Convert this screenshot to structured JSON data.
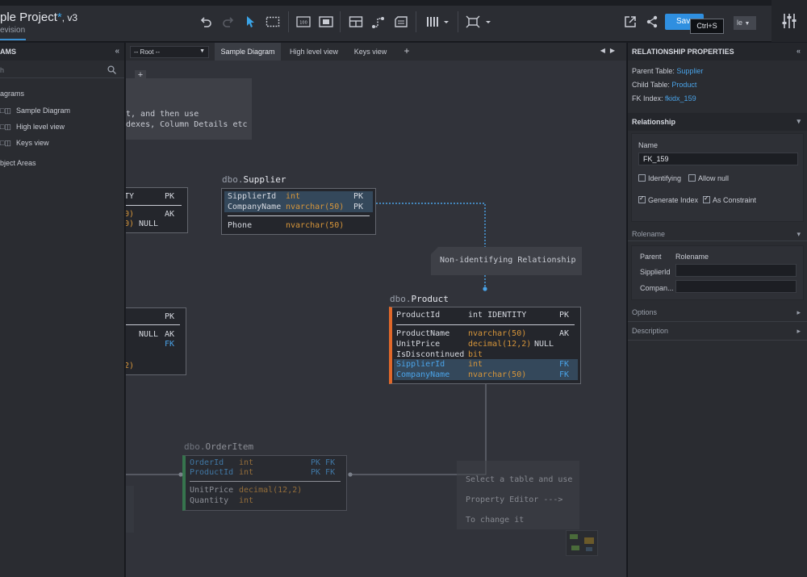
{
  "topbar": {
    "title": "ple Project",
    "title_star": "*",
    "title_version": ", v3",
    "subtitle": "evision",
    "save_label": "Save",
    "tooltip": "Ctrl+S",
    "lang_value": "le",
    "icons": [
      "undo-icon",
      "redo-icon",
      "pointer-icon",
      "marquee-icon",
      "text-box-icon",
      "frame-icon",
      "table-icon",
      "relationship-icon",
      "note-icon",
      "align-icon",
      "fit-icon",
      "export-icon",
      "share-icon",
      "settings-sliders-icon"
    ]
  },
  "left_panel": {
    "header": "AMS",
    "collapse": "«",
    "search_placeholder": "h",
    "group_diagrams": "agrams",
    "items": [
      {
        "label": "Sample Diagram"
      },
      {
        "label": "High level view"
      },
      {
        "label": "Keys view"
      }
    ],
    "group_subject": "bject Areas"
  },
  "tabbar": {
    "root_value": "-- Root --",
    "tabs": [
      {
        "label": "Sample Diagram",
        "active": true
      },
      {
        "label": "High level view",
        "active": false
      },
      {
        "label": "Keys view",
        "active": false
      }
    ],
    "add": "+",
    "nav_prev": "◀",
    "nav_next": "▶"
  },
  "canvas": {
    "zoom_in": "+",
    "zoom_out": "−",
    "hint_line1": "t, and then use",
    "hint_line2": "dexes, Column Details etc",
    "left_card1": {
      "r1c1": "TY",
      "r1c2": "PK",
      "r2c1": "0)",
      "r2c2": "AK",
      "r3c1": "0)",
      "r3c2": "NULL"
    },
    "left_card2": {
      "r1": "PK",
      "r2a": "NULL",
      "r2b": "AK",
      "r3": "FK",
      "r4": "2)"
    },
    "supplier": {
      "schema": "dbo.",
      "name": "Supplier",
      "rows": [
        {
          "col": "SipplierId",
          "type": "int",
          "key": "PK"
        },
        {
          "col": "CompanyName",
          "type": "nvarchar(50)",
          "key": "PK"
        },
        {
          "col": "Phone",
          "type": "nvarchar(50)",
          "key": ""
        }
      ]
    },
    "product": {
      "schema": "dbo.",
      "name": "Product",
      "rows": [
        {
          "col": "ProductId",
          "type": "int IDENTITY",
          "key": "PK",
          "extra": ""
        },
        {
          "col": "ProductName",
          "type": "nvarchar(50)",
          "key": "AK",
          "extra": ""
        },
        {
          "col": "UnitPrice",
          "type": "decimal(12,2)",
          "key": "",
          "extra": "NULL"
        },
        {
          "col": "IsDiscontinued",
          "type": "bit",
          "key": "",
          "extra": ""
        },
        {
          "col": "SipplierId",
          "type": "int",
          "key": "FK",
          "extra": ""
        },
        {
          "col": "CompanyName",
          "type": "nvarchar(50)",
          "key": "FK",
          "extra": ""
        }
      ]
    },
    "orderitem": {
      "schema": "dbo.",
      "name": "OrderItem",
      "rows": [
        {
          "col": "OrderId",
          "type": "int",
          "key": "PK FK"
        },
        {
          "col": "ProductId",
          "type": "int",
          "key": "PK FK"
        },
        {
          "col": "UnitPrice",
          "type": "decimal(12,2)",
          "key": ""
        },
        {
          "col": "Quantity",
          "type": "int",
          "key": ""
        }
      ]
    },
    "rel_note": "Non-identifying Relationship",
    "select_note": {
      "line1": "Select a table and use",
      "line2": "Property Editor --->",
      "line3": "To change it"
    }
  },
  "right_panel": {
    "header": "RELATIONSHIP PROPERTIES",
    "collapse": "«",
    "parent_label": "Parent Table:",
    "parent_value": "Supplier",
    "child_label": "Child Table:",
    "child_value": "Product",
    "fk_label": "FK Index:",
    "fk_value": "fkidx_159",
    "relationship_section": "Relationship",
    "name_label": "Name",
    "name_value": "FK_159",
    "identifying": "Identifying",
    "allow_null": "Allow null",
    "generate_index": "Generate Index",
    "as_constraint": "As Constraint",
    "rolename_section": "Rolename",
    "col_parent": "Parent",
    "col_rolename": "Rolename",
    "role_rows": [
      "SipplierId",
      "Compan..."
    ],
    "options": "Options",
    "description": "Description"
  },
  "colors": {
    "accent": "#2f8fe0",
    "fk_blue": "#4aa3e8",
    "type_orange": "#d6953a",
    "product_stripe": "#e0682a",
    "orderitem_stripe": "#3aa05a"
  }
}
